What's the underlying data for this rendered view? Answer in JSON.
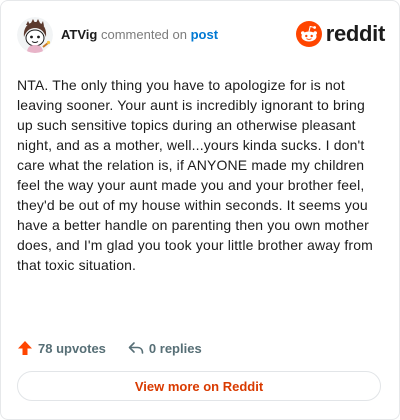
{
  "comment": {
    "username": "ATVig",
    "action_text": "commented on",
    "post_link": "post",
    "body": "NTA. The only thing you have to apologize for is not leaving sooner. Your aunt is incredibly ignorant to bring up such sensitive topics during an otherwise pleasant night, and as a mother, well...yours kinda sucks. I don't care what the relation is, if ANYONE made my children feel the way your aunt made you and your brother feel, they'd be out of my house within seconds. It seems you have a better handle on parenting then you own mother does, and I'm glad you took your little brother away from that toxic situation."
  },
  "brand": {
    "name": "reddit",
    "icon": "reddit-logo-icon",
    "color": "#ff4500"
  },
  "actions": {
    "upvotes": "78 upvotes",
    "replies": "0 replies",
    "upvote_icon": "upvote-arrow-icon",
    "reply_icon": "reply-arrow-icon"
  },
  "footer": {
    "view_more": "View more on Reddit"
  },
  "colors": {
    "accent": "#d93a00",
    "link": "#0079d3",
    "muted": "#576f76"
  }
}
